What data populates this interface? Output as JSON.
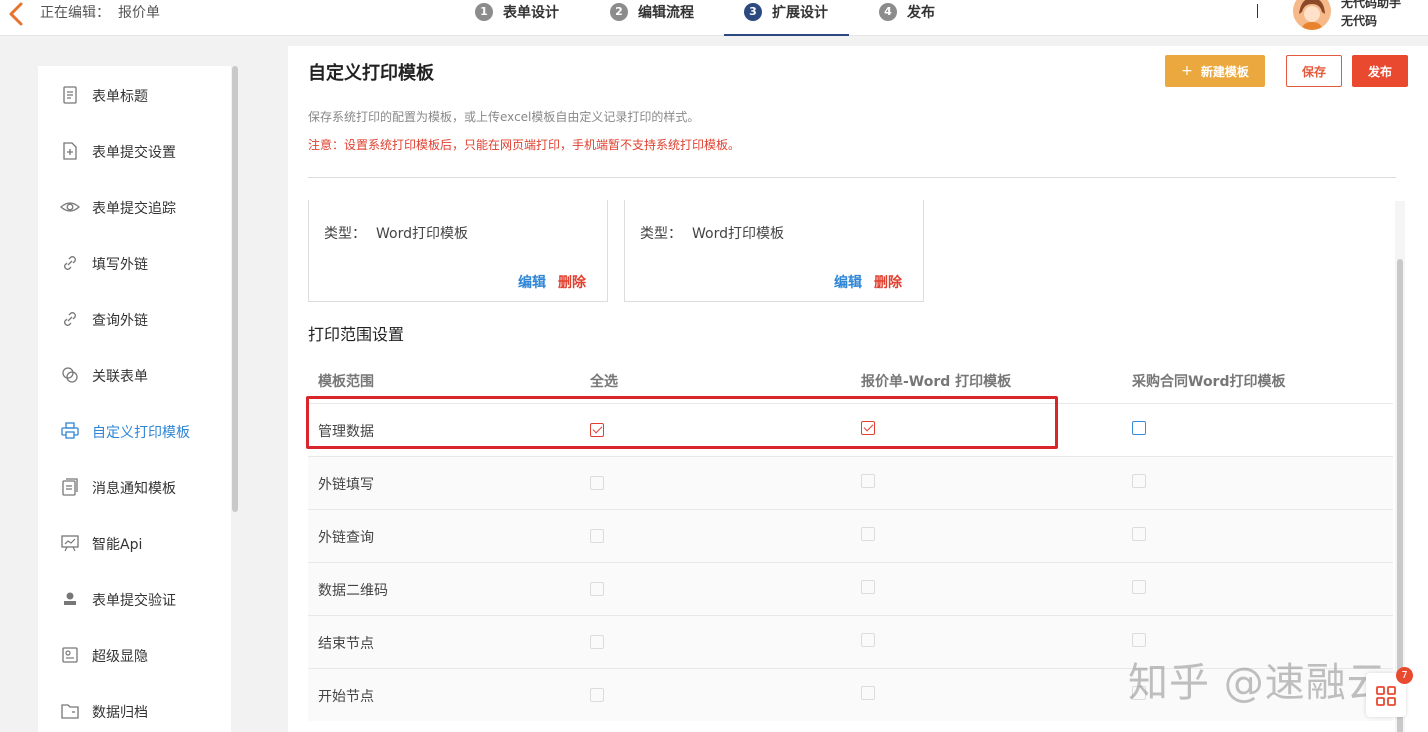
{
  "header": {
    "editing_label": "正在编辑：",
    "form_name": "报价单",
    "steps": [
      {
        "num": "1",
        "label": "表单设计"
      },
      {
        "num": "2",
        "label": "编辑流程"
      },
      {
        "num": "3",
        "label": "扩展设计"
      },
      {
        "num": "4",
        "label": "发布"
      }
    ],
    "active_step": 3,
    "user": {
      "name": "无代码助手",
      "sub": "无代码"
    }
  },
  "sidebar": {
    "items": [
      {
        "label": "表单标题",
        "icon": "document-icon"
      },
      {
        "label": "表单提交设置",
        "icon": "file-add-icon"
      },
      {
        "label": "表单提交追踪",
        "icon": "eye-icon"
      },
      {
        "label": "填写外链",
        "icon": "link-icon"
      },
      {
        "label": "查询外链",
        "icon": "link-icon"
      },
      {
        "label": "关联表单",
        "icon": "linked-circles-icon"
      },
      {
        "label": "自定义打印模板",
        "icon": "printer-icon"
      },
      {
        "label": "消息通知模板",
        "icon": "message-template-icon"
      },
      {
        "label": "智能Api",
        "icon": "presentation-icon"
      },
      {
        "label": "表单提交验证",
        "icon": "user-stamp-icon"
      },
      {
        "label": "超级显隐",
        "icon": "toggle-box-icon"
      },
      {
        "label": "数据归档",
        "icon": "folder-icon"
      }
    ],
    "active_index": 6
  },
  "main": {
    "title": "自定义打印模板",
    "buttons": {
      "new": "新建模板",
      "save": "保存",
      "publish": "发布"
    },
    "description": "保存系统打印的配置为模板，或上传excel模板自由定义记录打印的样式。",
    "note": "注意：设置系统打印模板后，只能在网页端打印，手机端暂不支持系统打印模板。",
    "cards": [
      {
        "type_label": "类型：",
        "type_value": "Word打印模板",
        "edit": "编辑",
        "delete": "删除"
      },
      {
        "type_label": "类型：",
        "type_value": "Word打印模板",
        "edit": "编辑",
        "delete": "删除"
      }
    ],
    "section_title": "打印范围设置",
    "table": {
      "headers": [
        "模板范围",
        "全选",
        "报价单-Word 打印模板",
        "采购合同Word打印模板"
      ],
      "rows": [
        {
          "label": "管理数据",
          "checks": [
            "checked",
            "checked",
            "blue"
          ]
        },
        {
          "label": "外链填写",
          "checks": [
            "empty",
            "empty",
            "empty"
          ]
        },
        {
          "label": "外链查询",
          "checks": [
            "empty",
            "empty",
            "empty"
          ]
        },
        {
          "label": "数据二维码",
          "checks": [
            "empty",
            "empty",
            "empty"
          ]
        },
        {
          "label": "结束节点",
          "checks": [
            "empty",
            "empty",
            "empty"
          ]
        },
        {
          "label": "开始节点",
          "checks": [
            "empty",
            "empty",
            "empty"
          ]
        }
      ]
    }
  },
  "watermark": "知乎 @速融云",
  "badge_count": "7",
  "colors": {
    "accent_blue": "#2f86d6",
    "step_active": "#2d4a80",
    "danger_red": "#e0402f",
    "new_button": "#eaa83f",
    "highlight_box": "#d8262a"
  }
}
